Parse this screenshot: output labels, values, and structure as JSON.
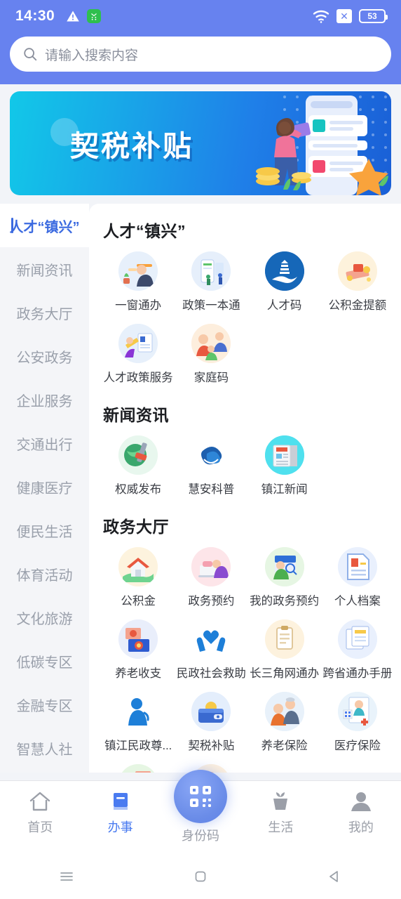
{
  "statusbar": {
    "time": "14:30",
    "battery_level": "53",
    "icons": [
      "warning-triangle-icon",
      "green-app-icon",
      "wifi-icon",
      "no-sim-icon",
      "battery-icon"
    ]
  },
  "search": {
    "placeholder": "请输入搜索内容",
    "icon": "search-icon"
  },
  "banner": {
    "title": "契税补贴"
  },
  "sidebar": {
    "items": [
      {
        "label": "人才“镇兴”",
        "active": true
      },
      {
        "label": "新闻资讯",
        "active": false
      },
      {
        "label": "政务大厅",
        "active": false
      },
      {
        "label": "公安政务",
        "active": false
      },
      {
        "label": "企业服务",
        "active": false
      },
      {
        "label": "交通出行",
        "active": false
      },
      {
        "label": "健康医疗",
        "active": false
      },
      {
        "label": "便民生活",
        "active": false
      },
      {
        "label": "体育活动",
        "active": false
      },
      {
        "label": "文化旅游",
        "active": false
      },
      {
        "label": "低碳专区",
        "active": false
      },
      {
        "label": "金融专区",
        "active": false
      },
      {
        "label": "智慧人社",
        "active": false
      }
    ]
  },
  "sections": [
    {
      "title": "人才“镇兴”",
      "items": [
        {
          "label": "一窗通办",
          "icon": "service-window-icon",
          "bg": "#e7f0fb"
        },
        {
          "label": "政策一本通",
          "icon": "policy-book-icon",
          "bg": "#e6effb"
        },
        {
          "label": "人才码",
          "icon": "talent-code-icon",
          "bg": "#1667b8"
        },
        {
          "label": "公积金提额",
          "icon": "fund-increase-icon",
          "bg": "#fdf2dc"
        },
        {
          "label": "人才政策服务",
          "icon": "talent-policy-icon",
          "bg": "#e7f0fb"
        },
        {
          "label": "家庭码",
          "icon": "family-code-icon",
          "bg": "#fdeedd"
        }
      ]
    },
    {
      "title": "新闻资讯",
      "items": [
        {
          "label": "权威发布",
          "icon": "authority-release-icon",
          "bg": "#e8f7ee"
        },
        {
          "label": "慧安科普",
          "icon": "huian-science-icon",
          "bg": "#ffffff"
        },
        {
          "label": "镇江新闻",
          "icon": "zhenjiang-news-icon",
          "bg": "#4fe0ee"
        }
      ]
    },
    {
      "title": "政务大厅",
      "items": [
        {
          "label": "公积金",
          "icon": "housing-fund-icon",
          "bg": "#fdf3de"
        },
        {
          "label": "政务预约",
          "icon": "gov-appointment-icon",
          "bg": "#fde5e9"
        },
        {
          "label": "我的政务预约",
          "icon": "my-appointment-icon",
          "bg": "#e6f6e3"
        },
        {
          "label": "个人档案",
          "icon": "personal-file-icon",
          "bg": "#e9f0fd"
        },
        {
          "label": "养老收支",
          "icon": "pension-income-icon",
          "bg": "#e9eefb"
        },
        {
          "label": "民政社会救助",
          "icon": "social-assistance-icon",
          "bg": "#ffffff"
        },
        {
          "label": "长三角网通办",
          "icon": "yangtze-online-icon",
          "bg": "#fdf2de"
        },
        {
          "label": "跨省通办手册",
          "icon": "cross-province-icon",
          "bg": "#e9f0fd"
        },
        {
          "label": "镇江民政尊...",
          "icon": "zhenjiang-civil-icon",
          "bg": "#ffffff"
        },
        {
          "label": "契税补贴",
          "icon": "deed-tax-subsidy-icon",
          "bg": "#e4eefc"
        },
        {
          "label": "养老保险",
          "icon": "pension-insurance-icon",
          "bg": "#e8f1fa"
        },
        {
          "label": "医疗保险",
          "icon": "medical-insurance-icon",
          "bg": "#e9f3fb"
        },
        {
          "label": "",
          "icon": "partial-row-icon-a",
          "bg": "#e6f6e3"
        },
        {
          "label": "",
          "icon": "partial-row-icon-b",
          "bg": "#fdf0de"
        }
      ]
    }
  ],
  "tabbar": {
    "items": [
      {
        "label": "首页",
        "icon": "home-icon",
        "active": false
      },
      {
        "label": "办事",
        "icon": "book-icon",
        "active": true
      },
      {
        "label": "身份码",
        "icon": "qr-code-icon",
        "active": false
      },
      {
        "label": "生活",
        "icon": "plant-icon",
        "active": false
      },
      {
        "label": "我的",
        "icon": "person-icon",
        "active": false
      }
    ]
  },
  "androidnav": {
    "items": [
      "recents-icon",
      "home-square-icon",
      "back-triangle-icon"
    ]
  },
  "colors": {
    "accent": "#4a7bf0",
    "header": "#6782ef",
    "page_bg": "#f2f4f8"
  }
}
